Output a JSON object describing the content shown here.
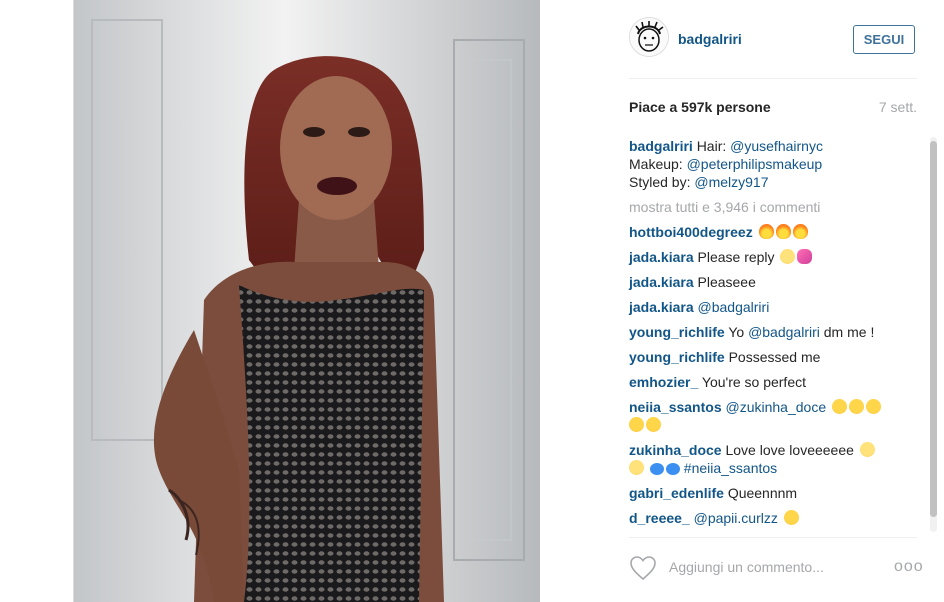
{
  "post": {
    "username": "badgalriri",
    "follow_label": "SEGUI",
    "likes": "Piace a 597k persone",
    "time_ago": "7 sett."
  },
  "caption": {
    "user": "badgalriri",
    "hair_label": "Hair:",
    "hair_mention": "@yusefhairnyc",
    "makeup_label": "Makeup:",
    "makeup_mention": "@peterphilipsmakeup",
    "styled_label": "Styled by:",
    "styled_mention": "@melzy917"
  },
  "show_all": "mostra tutti e 3,946 i commenti",
  "comments": [
    {
      "user": "hottboi400degreez",
      "text": "",
      "emoji": [
        "fire",
        "fire",
        "fire"
      ]
    },
    {
      "user": "jada.kiara",
      "text": "Please reply",
      "emoji": [
        "flushed",
        "pink-hearts"
      ]
    },
    {
      "user": "jada.kiara",
      "text": "Pleaseee"
    },
    {
      "user": "jada.kiara",
      "mention": "@badgalriri"
    },
    {
      "user": "young_richlife",
      "text": "Yo",
      "mention": "@badgalriri",
      "text2": "dm me !"
    },
    {
      "user": "young_richlife",
      "text": "Possessed me"
    },
    {
      "user": "emhozier_",
      "text": "You're so perfect"
    },
    {
      "user": "neiia_ssantos",
      "mention": "@zukinha_doce",
      "emoji": [
        "heart-eyes",
        "heart-eyes",
        "heart-eyes",
        "heart-eyes",
        "heart-eyes"
      ]
    },
    {
      "user": "zukinha_doce",
      "text": "Love love loveeeeee",
      "mention": "#neiia_ssantos",
      "emoji": [
        "wink",
        "wink",
        "blue-heart",
        "blue-heart"
      ]
    },
    {
      "user": "gabri_edenlife",
      "text": "Queennnm"
    },
    {
      "user": "d_reeee_",
      "mention": "@papii.curlzz",
      "emoji": [
        "heart-eyes"
      ]
    }
  ],
  "footer": {
    "add_comment_placeholder": "Aggiungi un commento...",
    "more_label": "ooo"
  },
  "colors": {
    "username": "#125688",
    "follow": "#3f729b",
    "muted": "#a5a7aa"
  }
}
